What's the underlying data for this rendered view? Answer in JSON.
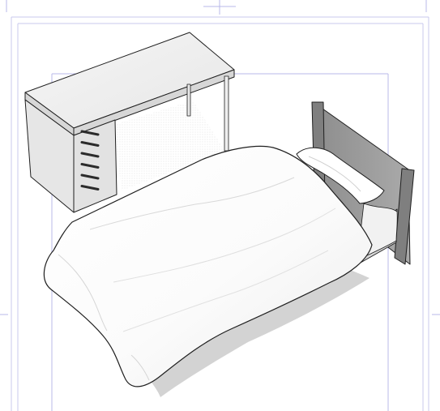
{
  "canvas": {
    "background": "#ffffff",
    "guide_color": "#b9b9ea",
    "frame_color": "#c9c9ee"
  },
  "scene": {
    "objects": [
      "desk",
      "drawer-unit",
      "single-bed",
      "pillow",
      "duvet",
      "headboard"
    ],
    "drawer_count": 6,
    "desk_leg_count": 2,
    "colors": {
      "desk_top": "#efefef",
      "desk_edge": "#d7d7d7",
      "drawer_front": "#e2e2e2",
      "drawer_handle": "#2b2b2b",
      "headboard": "#9d9d9d",
      "headboard_dark": "#7f7f7f",
      "duvet": "#ffffff",
      "shadow": "#d3d3d3",
      "outline": "#1f1f1f"
    }
  }
}
